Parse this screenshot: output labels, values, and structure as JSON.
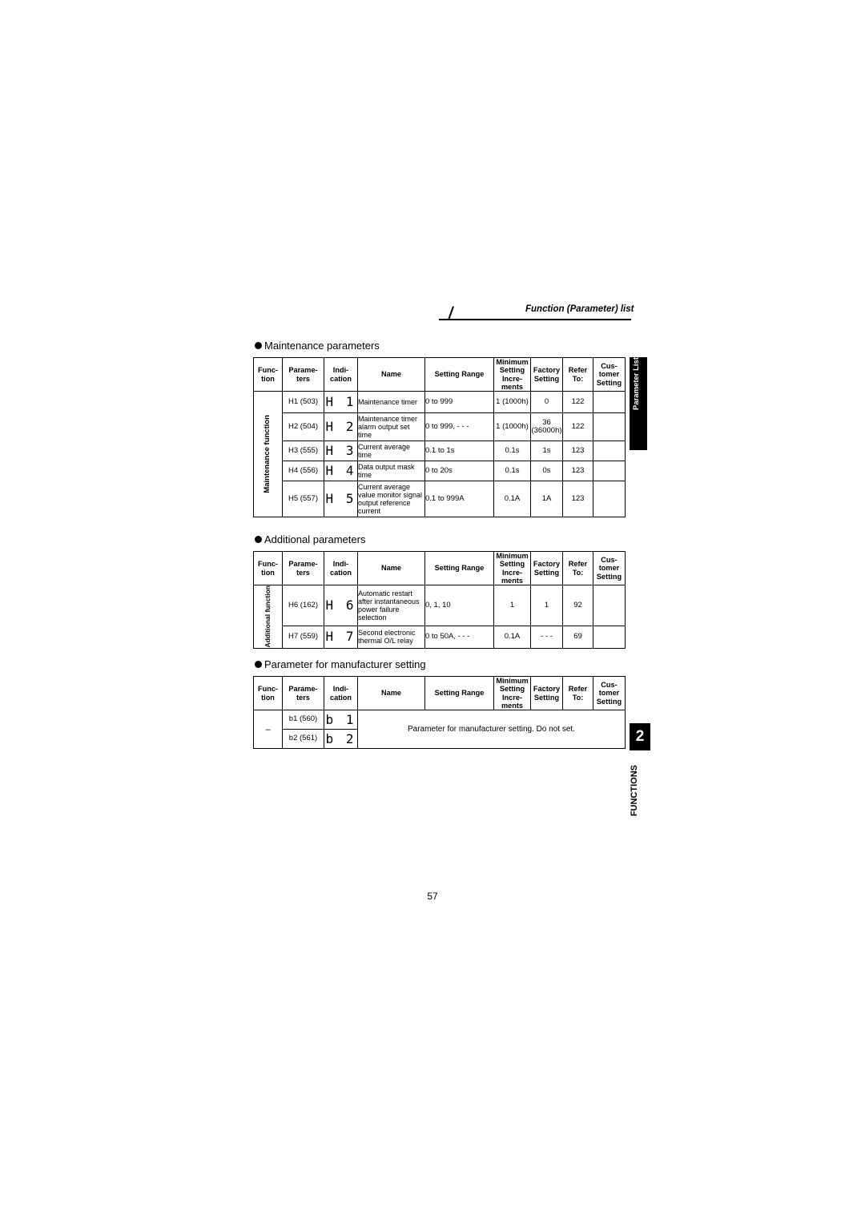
{
  "header": {
    "title": "Function (Parameter) list"
  },
  "page_number": "57",
  "side_tabs": {
    "parameter_list": "Parameter List",
    "chapter_number": "2",
    "chapter_label": "FUNCTIONS"
  },
  "columns": {
    "function": "Func-\ntion",
    "function_l1": "Func-",
    "function_l2": "tion",
    "parameters_l1": "Parame-",
    "parameters_l2": "ters",
    "indication_l1": "Indi-",
    "indication_l2": "cation",
    "name": "Name",
    "setting_range": "Setting Range",
    "minimum_l1": "Minimum",
    "minimum_l2": "Setting",
    "minimum_l3": "Incre-",
    "minimum_l4": "ments",
    "factory_l1": "Factory",
    "factory_l2": "Setting",
    "refer_l1": "Refer",
    "refer_l2": "To:",
    "customer_l1": "Cus-",
    "customer_l2": "tomer",
    "customer_l3": "Setting"
  },
  "sections": [
    {
      "id": "maintenance",
      "heading": "Maintenance parameters",
      "group_label": "Maintenance function",
      "rows": [
        {
          "parameter": "H1 (503)",
          "indication": "H 1",
          "name": "Maintenance timer",
          "setting_range": "0 to 999",
          "minimum": "1 (1000h)",
          "factory": "0",
          "refer": "122",
          "customer": ""
        },
        {
          "parameter": "H2 (504)",
          "indication": "H 2",
          "name": "Maintenance timer alarm output set time",
          "setting_range": "0 to 999, - - -",
          "minimum": "1 (1000h)",
          "factory": "36 (36000h)",
          "refer": "122",
          "customer": ""
        },
        {
          "parameter": "H3 (555)",
          "indication": "H 3",
          "name": "Current average time",
          "setting_range": "0.1 to 1s",
          "minimum": "0.1s",
          "factory": "1s",
          "refer": "123",
          "customer": ""
        },
        {
          "parameter": "H4 (556)",
          "indication": "H 4",
          "name": "Data output mask time",
          "setting_range": "0 to 20s",
          "minimum": "0.1s",
          "factory": "0s",
          "refer": "123",
          "customer": ""
        },
        {
          "parameter": "H5 (557)",
          "indication": "H 5",
          "name": "Current average value monitor signal output reference current",
          "setting_range": "0.1 to 999A",
          "minimum": "0.1A",
          "factory": "1A",
          "refer": "123",
          "customer": ""
        }
      ]
    },
    {
      "id": "additional",
      "heading": "Additional parameters",
      "group_label": "Additional function",
      "rows": [
        {
          "parameter": "H6 (162)",
          "indication": "H 6",
          "name": "Automatic restart after instantaneous power failure selection",
          "setting_range": "0, 1, 10",
          "minimum": "1",
          "factory": "1",
          "refer": "92",
          "customer": ""
        },
        {
          "parameter": "H7 (559)",
          "indication": "H 7",
          "name": "Second electronic thermal O/L relay",
          "setting_range": "0 to 50A, - - -",
          "minimum": "0.1A",
          "factory": "- - -",
          "refer": "69",
          "customer": ""
        }
      ]
    },
    {
      "id": "manufacturer",
      "heading": "Parameter for manufacturer setting",
      "group_label": "–",
      "note": "Parameter for manufacturer setting. Do not set.",
      "rows": [
        {
          "parameter": "b1 (560)",
          "indication": "b 1"
        },
        {
          "parameter": "b2 (561)",
          "indication": "b 2"
        }
      ]
    }
  ]
}
